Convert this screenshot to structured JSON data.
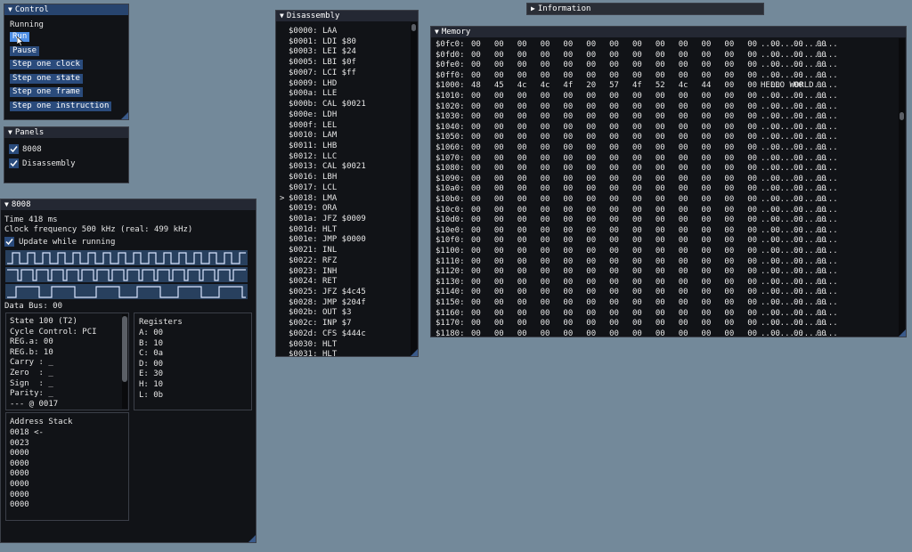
{
  "control": {
    "title": "Control",
    "status": "Running",
    "buttons": [
      "Run",
      "Pause",
      "Step one clock",
      "Step one state",
      "Step one frame",
      "Step one instruction"
    ]
  },
  "panels": {
    "title": "Panels",
    "items": [
      {
        "label": "8008",
        "checked": true
      },
      {
        "label": "Disassembly",
        "checked": true
      }
    ]
  },
  "cpu": {
    "title": "8008",
    "time": "Time 418 ms",
    "clock": "Clock frequency 500 kHz (real: 499 kHz)",
    "update_label": "Update while running",
    "data_bus": "Data Bus: 00",
    "state_lines": [
      "State 100 (T2)",
      "Cycle Control: PCI",
      "REG.a: 00",
      "REG.b: 10",
      "Carry : _",
      "Zero  : _",
      "Sign  : _",
      "Parity: _",
      "--- @ 0017"
    ],
    "registers_title": "Registers",
    "registers": [
      "A: 00",
      "B: 10",
      "C: 0a",
      "D: 00",
      "E: 30",
      "H: 10",
      "L: 0b"
    ],
    "stack_title": "Address Stack",
    "stack": [
      "0018 <-",
      "0023",
      "0000",
      "0000",
      "0000",
      "0000",
      "0000",
      "0000"
    ]
  },
  "disassembly": {
    "title": "Disassembly",
    "marker": ">",
    "marker_row": 16,
    "lines": [
      [
        "$0000:",
        "LAA"
      ],
      [
        "$0001:",
        "LDI $80"
      ],
      [
        "$0003:",
        "LEI $24"
      ],
      [
        "$0005:",
        "LBI $0f"
      ],
      [
        "$0007:",
        "LCI $ff"
      ],
      [
        "$0009:",
        "LHD"
      ],
      [
        "$000a:",
        "LLE"
      ],
      [
        "$000b:",
        "CAL $0021"
      ],
      [
        "$000e:",
        "LDH"
      ],
      [
        "$000f:",
        "LEL"
      ],
      [
        "$0010:",
        "LAM"
      ],
      [
        "$0011:",
        "LHB"
      ],
      [
        "$0012:",
        "LLC"
      ],
      [
        "$0013:",
        "CAL $0021"
      ],
      [
        "$0016:",
        "LBH"
      ],
      [
        "$0017:",
        "LCL"
      ],
      [
        "$0018:",
        "LMA"
      ],
      [
        "$0019:",
        "ORA"
      ],
      [
        "$001a:",
        "JFZ $0009"
      ],
      [
        "$001d:",
        "HLT"
      ],
      [
        "$001e:",
        "JMP $0000"
      ],
      [
        "$0021:",
        "INL"
      ],
      [
        "$0022:",
        "RFZ"
      ],
      [
        "$0023:",
        "INH"
      ],
      [
        "$0024:",
        "RET"
      ],
      [
        "$0025:",
        "JFZ $4c45"
      ],
      [
        "$0028:",
        "JMP $204f"
      ],
      [
        "$002b:",
        "OUT $3"
      ],
      [
        "$002c:",
        "INP $7"
      ],
      [
        "$002d:",
        "CFS $444c"
      ],
      [
        "$0030:",
        "HLT"
      ],
      [
        "$0031:",
        "HLT"
      ]
    ]
  },
  "information": {
    "title": "Information"
  },
  "memory": {
    "title": "Memory",
    "rows": [
      {
        "addr": "$0fc0:",
        "hex": "00 00 00 00 00 00 00 00 00 00 00 00 00 00 00 00",
        "ascii": "................"
      },
      {
        "addr": "$0fd0:",
        "hex": "00 00 00 00 00 00 00 00 00 00 00 00 00 00 00 00",
        "ascii": "................"
      },
      {
        "addr": "$0fe0:",
        "hex": "00 00 00 00 00 00 00 00 00 00 00 00 00 00 00 00",
        "ascii": "................"
      },
      {
        "addr": "$0ff0:",
        "hex": "00 00 00 00 00 00 00 00 00 00 00 00 00 00 00 00",
        "ascii": "................"
      },
      {
        "addr": "$1000:",
        "hex": "48 45 4c 4c 4f 20 57 4f 52 4c 44 00 00 00 00 00",
        "ascii": "HELLO WORLD....."
      },
      {
        "addr": "$1010:",
        "hex": "00 00 00 00 00 00 00 00 00 00 00 00 00 00 00 00",
        "ascii": "................"
      },
      {
        "addr": "$1020:",
        "hex": "00 00 00 00 00 00 00 00 00 00 00 00 00 00 00 00",
        "ascii": "................"
      },
      {
        "addr": "$1030:",
        "hex": "00 00 00 00 00 00 00 00 00 00 00 00 00 00 00 00",
        "ascii": "................"
      },
      {
        "addr": "$1040:",
        "hex": "00 00 00 00 00 00 00 00 00 00 00 00 00 00 00 00",
        "ascii": "................"
      },
      {
        "addr": "$1050:",
        "hex": "00 00 00 00 00 00 00 00 00 00 00 00 00 00 00 00",
        "ascii": "................"
      },
      {
        "addr": "$1060:",
        "hex": "00 00 00 00 00 00 00 00 00 00 00 00 00 00 00 00",
        "ascii": "................"
      },
      {
        "addr": "$1070:",
        "hex": "00 00 00 00 00 00 00 00 00 00 00 00 00 00 00 00",
        "ascii": "................"
      },
      {
        "addr": "$1080:",
        "hex": "00 00 00 00 00 00 00 00 00 00 00 00 00 00 00 00",
        "ascii": "................"
      },
      {
        "addr": "$1090:",
        "hex": "00 00 00 00 00 00 00 00 00 00 00 00 00 00 00 00",
        "ascii": "................"
      },
      {
        "addr": "$10a0:",
        "hex": "00 00 00 00 00 00 00 00 00 00 00 00 00 00 00 00",
        "ascii": "................"
      },
      {
        "addr": "$10b0:",
        "hex": "00 00 00 00 00 00 00 00 00 00 00 00 00 00 00 00",
        "ascii": "................"
      },
      {
        "addr": "$10c0:",
        "hex": "00 00 00 00 00 00 00 00 00 00 00 00 00 00 00 00",
        "ascii": "................"
      },
      {
        "addr": "$10d0:",
        "hex": "00 00 00 00 00 00 00 00 00 00 00 00 00 00 00 00",
        "ascii": "................"
      },
      {
        "addr": "$10e0:",
        "hex": "00 00 00 00 00 00 00 00 00 00 00 00 00 00 00 00",
        "ascii": "................"
      },
      {
        "addr": "$10f0:",
        "hex": "00 00 00 00 00 00 00 00 00 00 00 00 00 00 00 00",
        "ascii": "................"
      },
      {
        "addr": "$1100:",
        "hex": "00 00 00 00 00 00 00 00 00 00 00 00 00 00 00 00",
        "ascii": "................"
      },
      {
        "addr": "$1110:",
        "hex": "00 00 00 00 00 00 00 00 00 00 00 00 00 00 00 00",
        "ascii": "................"
      },
      {
        "addr": "$1120:",
        "hex": "00 00 00 00 00 00 00 00 00 00 00 00 00 00 00 00",
        "ascii": "................"
      },
      {
        "addr": "$1130:",
        "hex": "00 00 00 00 00 00 00 00 00 00 00 00 00 00 00 00",
        "ascii": "................"
      },
      {
        "addr": "$1140:",
        "hex": "00 00 00 00 00 00 00 00 00 00 00 00 00 00 00 00",
        "ascii": "................"
      },
      {
        "addr": "$1150:",
        "hex": "00 00 00 00 00 00 00 00 00 00 00 00 00 00 00 00",
        "ascii": "................"
      },
      {
        "addr": "$1160:",
        "hex": "00 00 00 00 00 00 00 00 00 00 00 00 00 00 00 00",
        "ascii": "................"
      },
      {
        "addr": "$1170:",
        "hex": "00 00 00 00 00 00 00 00 00 00 00 00 00 00 00 00",
        "ascii": "................"
      },
      {
        "addr": "$1180:",
        "hex": "00 00 00 00 00 00 00 00 00 00 00 00 00 00 00 00",
        "ascii": "................"
      }
    ]
  },
  "icons": {
    "collapse": "triangle-down-icon",
    "expand": "triangle-right-icon",
    "check": "checkmark-icon",
    "cursor": "mouse-cursor-icon"
  },
  "colors": {
    "background": "#73899a",
    "window": "#111317",
    "title_active": "#27446e",
    "button": "#2a4b7c",
    "button_active": "#4d8ee6"
  }
}
